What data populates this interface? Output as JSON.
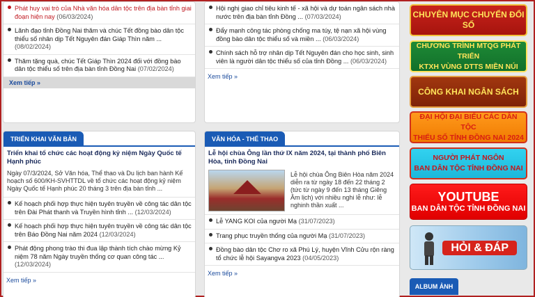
{
  "col1_top": {
    "items": [
      {
        "text": "Phát huy vai trò của Nhà văn hóa dân tộc trên địa bàn tỉnh giai đoạn hiện nay",
        "date": "(06/03/2024)"
      },
      {
        "text": "Lãnh đạo tỉnh Đồng Nai thăm và chúc Tết đồng bào dân tộc thiểu số nhân dịp Tết Nguyên đán Giáp Thìn năm ...",
        "date": "(08/02/2024)"
      },
      {
        "text": "Thăm tặng quà, chúc Tết Giáp Thìn 2024 đối với đồng bào dân tộc thiểu số trên địa bàn tỉnh Đồng Nai",
        "date": "(07/02/2024)"
      }
    ],
    "more": "Xem tiếp »"
  },
  "col2_top": {
    "items": [
      {
        "text": "Hội nghị giao chỉ tiêu kinh tế - xã hội và dự toán ngân sách nhà nước trên địa bàn tỉnh Đồng ...",
        "date": "(07/03/2024)"
      },
      {
        "text": "Đẩy mạnh công tác phòng chống ma túy, tệ nạn xã hội vùng đồng bào dân tộc thiểu số và miền ...",
        "date": "(06/03/2024)"
      },
      {
        "text": "Chính sách hỗ trợ nhân dịp Tết Nguyên đán cho học sinh, sinh viên là người dân tộc thiểu số của tỉnh Đồng ...",
        "date": "(06/03/2024)"
      }
    ],
    "more": "Xem tiếp »"
  },
  "trien_khai": {
    "heading": "TRIỂN KHAI VĂN BẢN",
    "feature_title": "Triển khai tổ chức các hoạt động kỷ niệm Ngày Quốc tế Hạnh phúc",
    "feature_desc": "Ngày 07/3/2024, Sở Văn hóa, Thể thao và Du lịch ban hành Kế hoạch số 600/KH-SVHTTDL về tổ chức các hoạt động kỷ niệm Ngày Quốc tế Hạnh phúc 20 tháng 3 trên địa bàn tỉnh ...",
    "items": [
      {
        "text": "Kế hoạch phối hợp thực hiện tuyên truyền về công tác dân tộc trên Đài Phát thanh và Truyền hình tỉnh ...",
        "date": "(12/03/2024)"
      },
      {
        "text": "Kế hoạch phối hợp thực hiện tuyên truyền về công tác dân tộc trên Báo Đồng Nai năm 2024",
        "date": "(12/03/2024)"
      },
      {
        "text": "Phát động phong trào thi đua lập thành tích chào mừng Kỷ niệm 78 năm Ngày truyền thống cơ quan công tác ...",
        "date": "(12/03/2024)"
      }
    ],
    "more": "Xem tiếp »"
  },
  "van_hoa": {
    "heading": "VĂN HÓA - THỂ THAO",
    "feature_title": "Lễ hội chùa Ông lần thứ IX năm 2024, tại thành phố Biên Hòa, tỉnh Đồng Nai",
    "feature_desc": "Lễ hội chùa Ông Biên Hòa năm 2024 diễn ra từ ngày 18 đến 22 tháng 2 (tức từ ngày 9 đến 13 tháng Giêng Âm lịch) với nhiều nghi lễ như: lễ nghinh thần xuất ...",
    "items": [
      {
        "text": "Lễ YANG KOI của người Mạ",
        "date": "(31/07/2023)"
      },
      {
        "text": "Trang phục truyền thống của người Mạ",
        "date": "(31/07/2023)"
      },
      {
        "text": "Đồng bào dân tộc Chơ ro xã Phú Lý, huyện Vĩnh Cửu rộn ràng tổ chức lễ hội Sayangva 2023",
        "date": "(04/05/2023)"
      }
    ],
    "more": "Xem tiếp »"
  },
  "sidebar": {
    "b1": "CHUYÊN MỤC CHUYỂN ĐỔI SỐ",
    "b2a": "CHƯƠNG TRÌNH MTQG PHÁT TRIỂN",
    "b2b": "KTXH VÙNG DTTS MIỀN NÚI",
    "b3": "CÔNG KHAI NGÂN SÁCH",
    "b4a": "ĐẠI HỘI ĐẠI BIỂU CÁC DÂN TỘC",
    "b4b": "THIỂU SỐ TỈNH ĐỒNG NAI 2024",
    "b5a": "NGƯỜI PHÁT NGÔN",
    "b5b": "BAN DÂN TỘC TỈNH ĐỒNG NAI",
    "b6a": "YOUTUBE",
    "b6b": "BAN DÂN TỘC TỈNH ĐỒNG NAI",
    "b7": "HỎI & ĐÁP",
    "album": "ALBUM ẢNH"
  }
}
